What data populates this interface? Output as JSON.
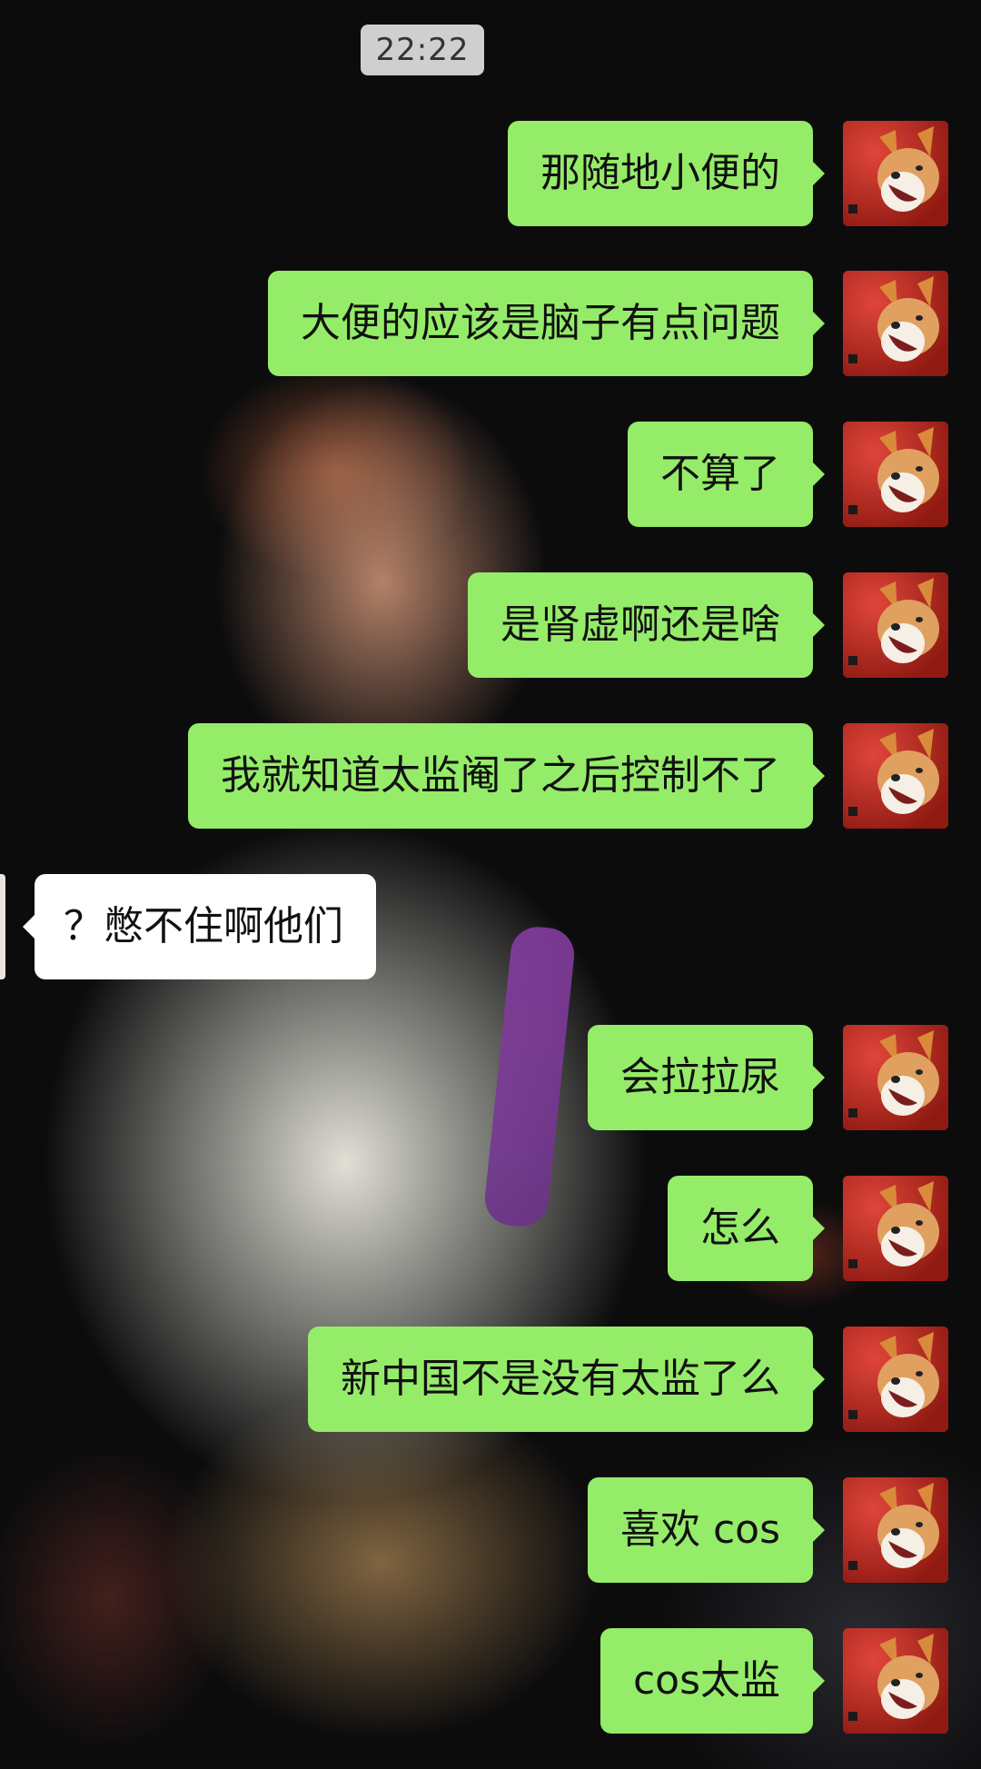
{
  "time": "22:22",
  "messages": [
    {
      "side": "out",
      "text": "那随地小便的"
    },
    {
      "side": "out",
      "text": "大便的应该是脑子有点问题"
    },
    {
      "side": "out",
      "text": "不算了"
    },
    {
      "side": "out",
      "text": "是肾虚啊还是啥"
    },
    {
      "side": "out",
      "text": "我就知道太监阉了之后控制不了"
    },
    {
      "side": "in",
      "text": "？憋不住啊他们"
    },
    {
      "side": "out",
      "text": "会拉拉尿"
    },
    {
      "side": "out",
      "text": "怎么"
    },
    {
      "side": "out",
      "text": "新中国不是没有太监了么"
    },
    {
      "side": "out",
      "text": "喜欢 cos"
    },
    {
      "side": "out",
      "text": "cos太监"
    }
  ],
  "colors": {
    "outgoing_bubble": "#95ec69",
    "incoming_bubble": "#ffffff",
    "avatar_bg": "#c3261c"
  }
}
